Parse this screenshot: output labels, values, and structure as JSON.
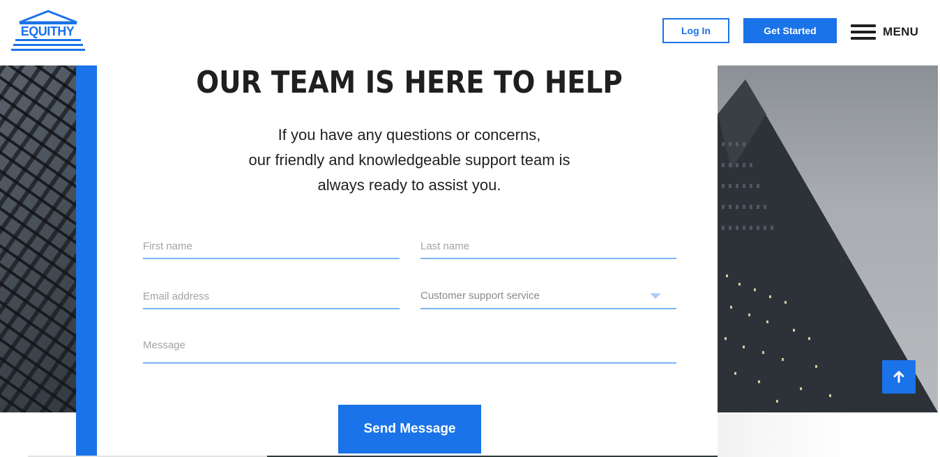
{
  "brand": {
    "logo_text": "EQUITHY",
    "accent": "#1a73e8"
  },
  "header": {
    "login_label": "Log In",
    "get_started_label": "Get Started",
    "menu_label": "MENU"
  },
  "contact": {
    "title": "OUR TEAM IS HERE TO HELP",
    "subtitle_lines": [
      "If you have any questions or concerns,",
      "our friendly and knowledgeable support team is",
      "always ready to assist you."
    ],
    "form": {
      "first_name_placeholder": "First name",
      "last_name_placeholder": "Last name",
      "email_placeholder": "Email address",
      "service_selected": "Customer support service",
      "message_placeholder": "Message",
      "submit_label": "Send Message"
    }
  },
  "icons": {
    "scroll_top": "arrow-up-icon",
    "menu": "hamburger-icon",
    "dropdown": "chevron-down-icon"
  }
}
